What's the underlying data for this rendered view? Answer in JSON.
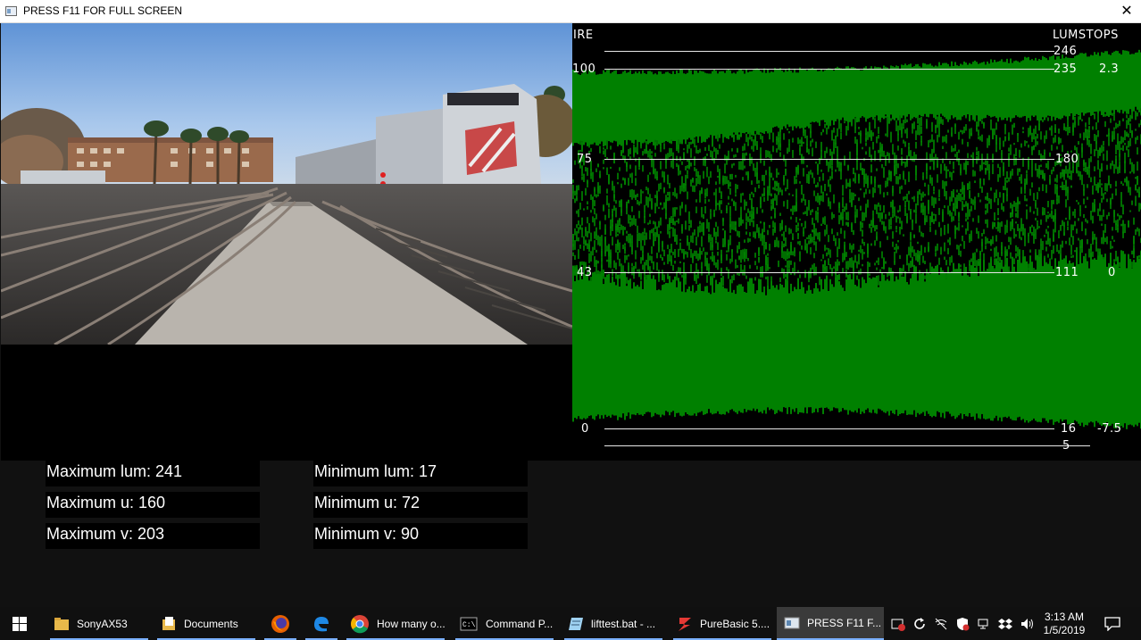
{
  "window": {
    "title": "PRESS F11 FOR FULL SCREEN",
    "close_glyph": "✕"
  },
  "scope": {
    "left_header": "IRE",
    "right_header": "LUMSTOPS",
    "trace_color": "#008000",
    "graticule": [
      {
        "ire": "",
        "lum": "246",
        "stops": ""
      },
      {
        "ire": "100",
        "lum": "235",
        "stops": "2.3"
      },
      {
        "ire": "75",
        "lum": "180",
        "stops": ""
      },
      {
        "ire": "43",
        "lum": "111",
        "stops": "0"
      },
      {
        "ire": "0",
        "lum": "16",
        "stops": "-7.5"
      },
      {
        "ire": "",
        "lum": "5",
        "stops": ""
      }
    ]
  },
  "stats": {
    "max_lum": "Maximum lum:  241",
    "max_u": "Maximum u:  160",
    "max_v": "Maximum v:  203",
    "min_lum": "Minimum lum:  17",
    "min_u": "Minimum u:  72",
    "min_v": "Minimum v:  90"
  },
  "taskbar": {
    "items": [
      {
        "label": "SonyAX53",
        "icon": "folder-icon"
      },
      {
        "label": "Documents",
        "icon": "documents-icon"
      },
      {
        "label": "",
        "icon": "firefox-icon"
      },
      {
        "label": "",
        "icon": "edge-icon"
      },
      {
        "label": "How many o...",
        "icon": "chrome-icon"
      },
      {
        "label": "Command P...",
        "icon": "cmd-icon"
      },
      {
        "label": "lifttest.bat - ...",
        "icon": "notepad-icon"
      },
      {
        "label": "PureBasic 5....",
        "icon": "purebasic-icon"
      },
      {
        "label": "PRESS F11 F...",
        "icon": "app-window-icon"
      }
    ],
    "time": "3:13 AM",
    "date": "1/5/2019"
  }
}
